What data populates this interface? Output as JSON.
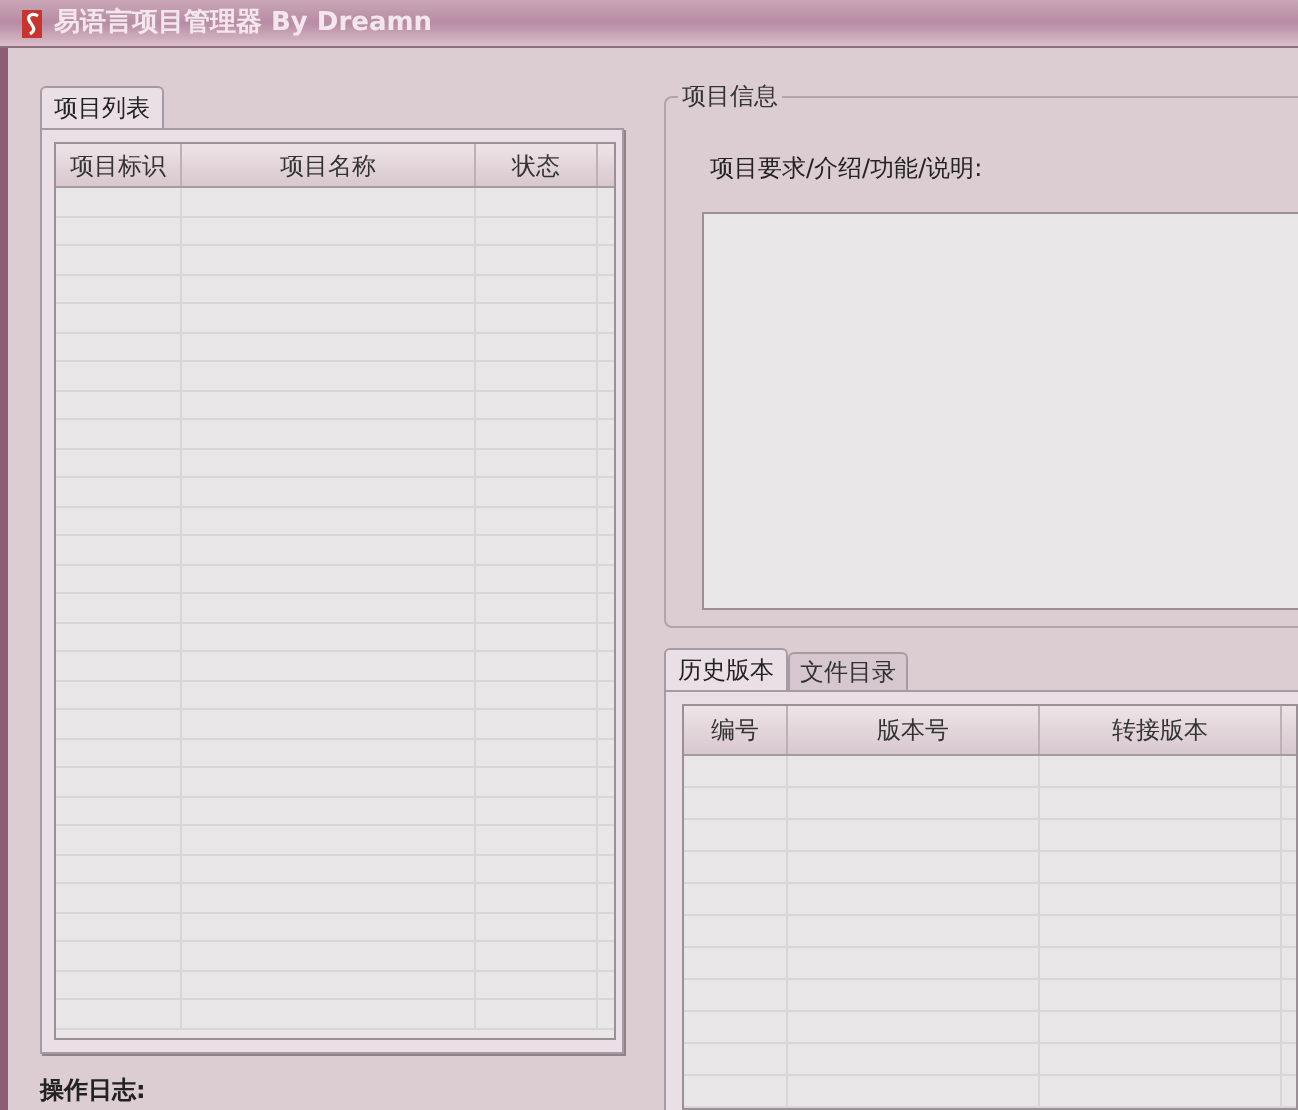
{
  "window": {
    "title": "易语言项目管理器 By Dreamn"
  },
  "project_list": {
    "tabs": [
      {
        "label": "项目列表",
        "selected": true
      }
    ],
    "columns": [
      "项目标识",
      "项目名称",
      "状态"
    ]
  },
  "project_info": {
    "title": "项目信息",
    "description_label": "项目要求/介绍/功能/说明:"
  },
  "history": {
    "tabs": [
      {
        "label": "历史版本",
        "selected": true
      },
      {
        "label": "文件目录",
        "selected": false
      }
    ],
    "columns": [
      "编号",
      "版本号",
      "转接版本"
    ]
  },
  "log_label": "操作日志:"
}
